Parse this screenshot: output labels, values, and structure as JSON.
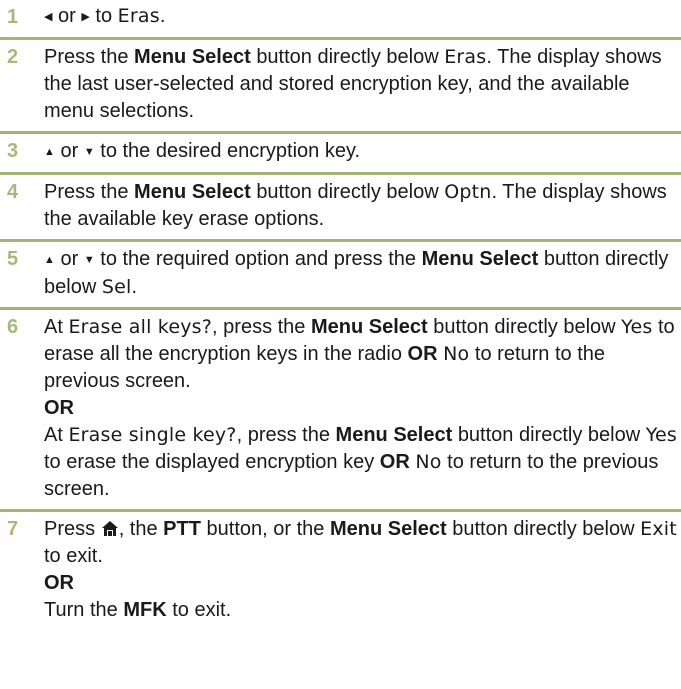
{
  "steps": [
    {
      "num": "1",
      "left_arrow": "◀",
      "or": "or",
      "right_arrow": "▶",
      "to": "to",
      "eras": "Eras",
      "end": "."
    },
    {
      "num": "2",
      "press": "Press the",
      "menu_select": "Menu Select",
      "button_below": "button directly below",
      "eras": "Eras",
      "rest": ". The display shows the last user-selected and stored encryption key, and the available menu selections."
    },
    {
      "num": "3",
      "up_arrow": "▲",
      "or": "or",
      "down_arrow": "▼",
      "rest": "to the desired encryption key."
    },
    {
      "num": "4",
      "press": "Press the",
      "menu_select": "Menu Select",
      "button_below": "button directly below",
      "optn": "Optn",
      "rest": ". The display shows the available key erase options."
    },
    {
      "num": "5",
      "up_arrow": "▲",
      "or": "or",
      "down_arrow": "▼",
      "mid": "to the required option and press the",
      "menu_select": "Menu Select",
      "button_below": "button directly below",
      "sel": "Sel",
      "end": "."
    },
    {
      "num": "6",
      "at1": "At",
      "erase_all": "Erase all keys?",
      "press1": ", press the",
      "menu_select1": "Menu Select",
      "button_below1": "button directly below",
      "yes1": "Yes",
      "rest1": "to erase all the encryption keys in the radio",
      "or_bold1": "OR",
      "no1": "No",
      "rest1b": "to return to the previous screen.",
      "or_line": "OR",
      "at2": "At",
      "erase_single": "Erase single key?",
      "press2": ", press the",
      "menu_select2": "Menu Select",
      "button_below2": "button directly below",
      "yes2": "Yes",
      "rest2": "to erase the displayed encryption key",
      "or_bold2": "OR",
      "no2": "No",
      "rest2b": "to return to the previous screen."
    },
    {
      "num": "7",
      "press": "Press",
      "home_icon": "home-icon",
      "mid1": ", the",
      "ptt": "PTT",
      "mid2": "button, or the",
      "menu_select": "Menu Select",
      "button_below": "button directly below",
      "exit": "Exit",
      "rest": "to exit.",
      "or_line": "OR",
      "turn": "Turn the",
      "mfk": "MFK",
      "rest2": "to exit."
    }
  ]
}
